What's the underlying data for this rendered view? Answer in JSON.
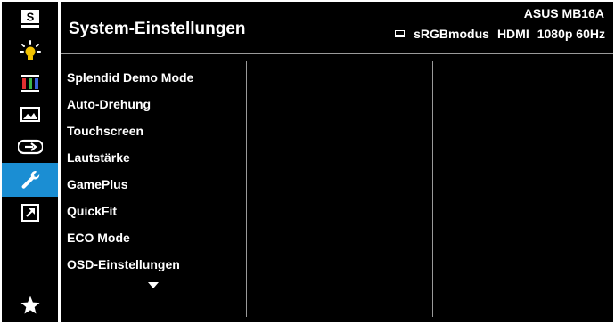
{
  "header": {
    "title": "System-Einstellungen",
    "model": "ASUS MB16A",
    "status": [
      "sRGBmodus",
      "HDMI",
      "1080p 60Hz"
    ]
  },
  "sidebar": {
    "items": [
      {
        "icon": "splendid-s-icon",
        "active": false
      },
      {
        "icon": "bluelight-filter-icon",
        "active": false
      },
      {
        "icon": "color-bars-icon",
        "active": false
      },
      {
        "icon": "image-icon",
        "active": false
      },
      {
        "icon": "input-select-icon",
        "active": false
      },
      {
        "icon": "wrench-icon",
        "active": true
      },
      {
        "icon": "shortcut-arrow-icon",
        "active": false
      },
      {
        "icon": "star-icon",
        "active": false
      }
    ]
  },
  "menu": {
    "items": [
      "Splendid Demo Mode",
      "Auto-Drehung",
      "Touchscreen",
      "Lautstärke",
      "GamePlus",
      "QuickFit",
      "ECO Mode",
      "OSD-Einstellungen"
    ]
  },
  "colors": {
    "accent": "#1b8ed3",
    "background": "#000000",
    "text": "#ffffff",
    "divider": "#9a9a9a"
  }
}
